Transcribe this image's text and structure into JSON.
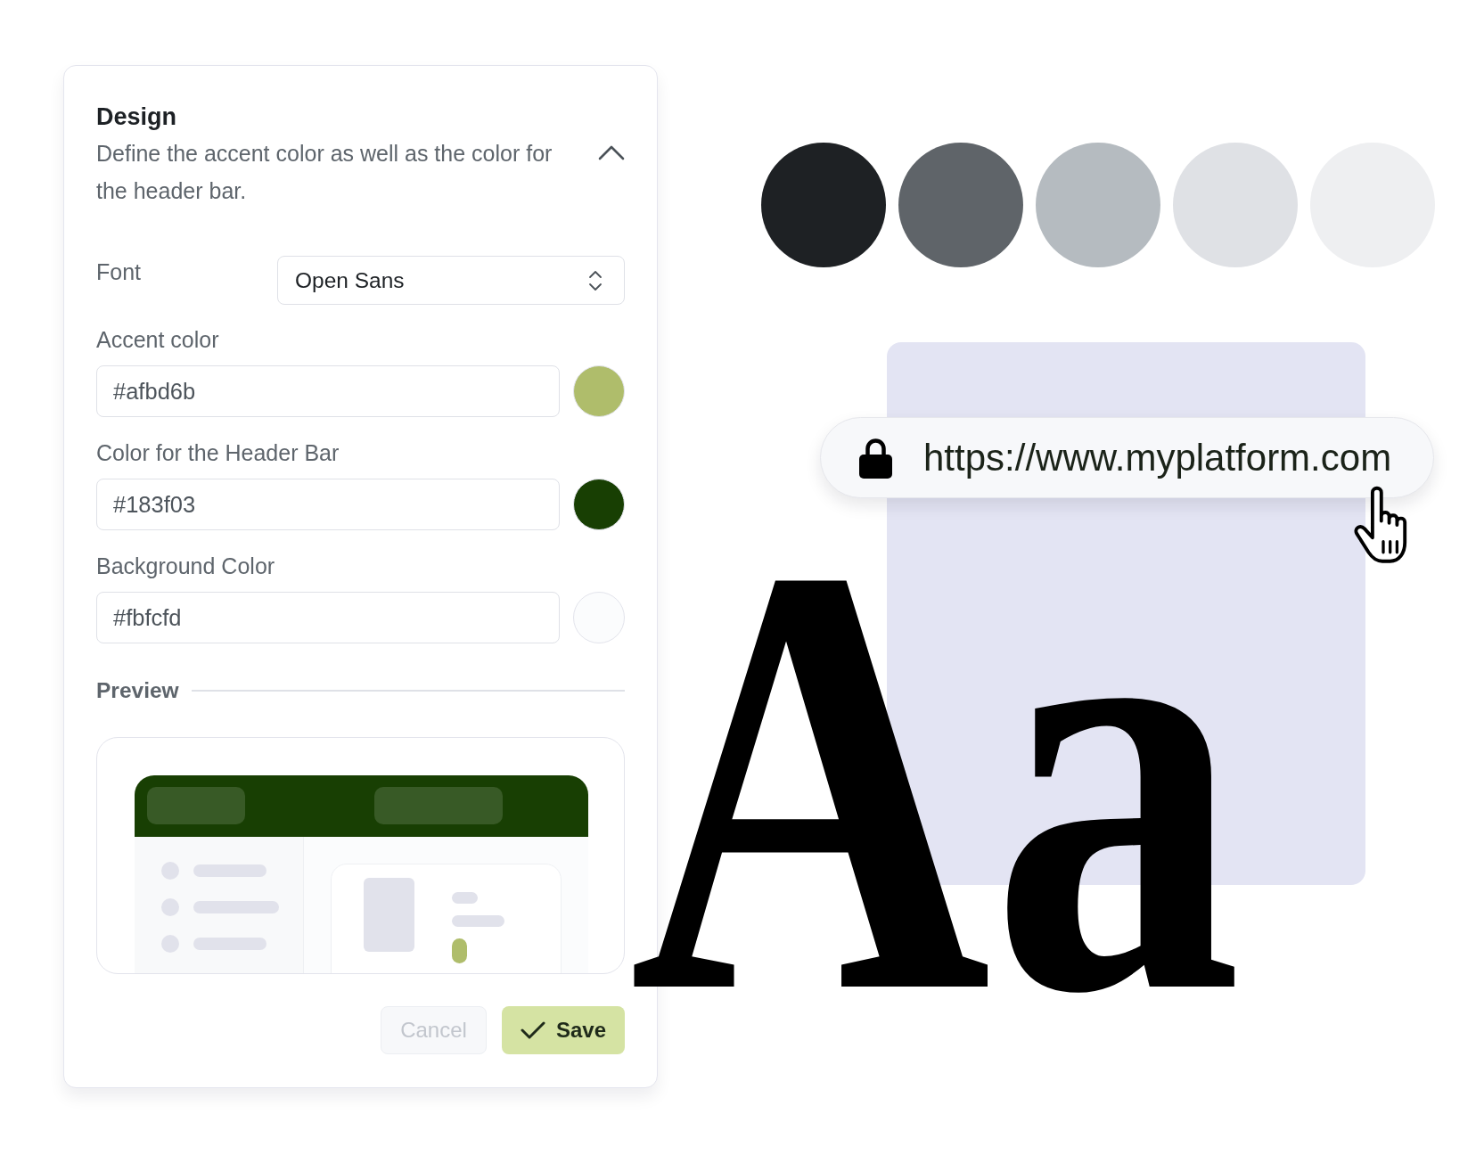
{
  "design_panel": {
    "title": "Design",
    "description": "Define the accent color as well as the color for the header bar.",
    "expanded": true,
    "font_field": {
      "label": "Font",
      "value": "Open Sans"
    },
    "color_fields": [
      {
        "label": "Accent color",
        "value": "#afbd6b",
        "color": "#afbd6b"
      },
      {
        "label": "Color for the Header Bar",
        "value": "#183f03",
        "color": "#183f03"
      },
      {
        "label": "Background Color",
        "value": "#fbfcfd",
        "color": "#fbfcfd"
      }
    ],
    "preview": {
      "title": "Preview"
    },
    "buttons": [
      {
        "label": "Cancel",
        "kind": "secondary",
        "disabled": true
      },
      {
        "label": "Save",
        "kind": "primary",
        "disabled": false
      }
    ]
  },
  "palette": [
    {
      "color": "#1e2124"
    },
    {
      "color": "#5f6469"
    },
    {
      "color": "#b5bbc0"
    },
    {
      "color": "#dfe1e5"
    },
    {
      "color": "#eeeff1"
    }
  ],
  "address_bar": {
    "url": "https://www.myplatform.com"
  },
  "specimen": {
    "text": "Aa"
  }
}
